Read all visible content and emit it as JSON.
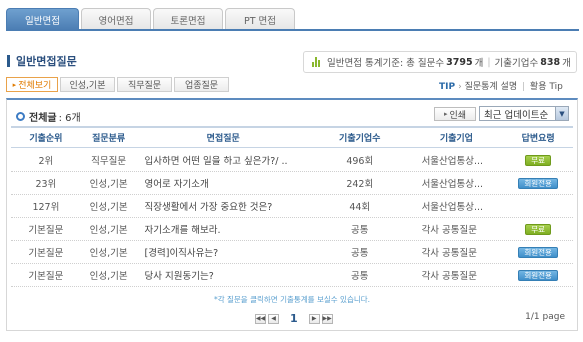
{
  "top_tabs": [
    {
      "label": "일반면접",
      "active": true
    },
    {
      "label": "영어면접",
      "active": false
    },
    {
      "label": "토론면접",
      "active": false
    },
    {
      "label": "PT 면접",
      "active": false
    }
  ],
  "section_title": "일반면접질문",
  "stats": {
    "prefix": "일반면접 통계기준: 총 질문수",
    "question_count": "3795",
    "unit1": "개",
    "company_label": "기출기업수",
    "company_count": "838",
    "unit2": "개"
  },
  "sub_tabs": [
    {
      "label": "전체보기",
      "active": true
    },
    {
      "label": "인성,기본",
      "active": false
    },
    {
      "label": "직무질문",
      "active": false
    },
    {
      "label": "업종질문",
      "active": false
    }
  ],
  "tip": {
    "label": "TIP",
    "link1": "질문통계 설명",
    "link2": "활용 Tip"
  },
  "list": {
    "total_label": "전체글",
    "total_count": ": 6개",
    "print_label": "인쇄",
    "sort_selected": "최근 업데이트순",
    "columns": [
      "기출순위",
      "질문분류",
      "면접질문",
      "기출기업수",
      "기출기업",
      "답변요령"
    ],
    "rows": [
      {
        "rank": "2위",
        "category": "직무질문",
        "question": "입사하면 어떤 일을 하고 싶은가?/ ..",
        "count": "496회",
        "company": "서울산업통상...",
        "answer": "무료",
        "answer_type": "free"
      },
      {
        "rank": "23위",
        "category": "인성,기본",
        "question": "영어로 자기소개",
        "count": "242회",
        "company": "서울산업통상...",
        "answer": "회원전용",
        "answer_type": "member"
      },
      {
        "rank": "127위",
        "category": "인성,기본",
        "question": "직장생활에서 가장 중요한 것은?",
        "count": "44회",
        "company": "서울산업통상...",
        "answer": "",
        "answer_type": "none"
      },
      {
        "rank": "기본질문",
        "category": "인성,기본",
        "question": "자기소개를 해보라.",
        "count": "공통",
        "company": "각사 공통질문",
        "answer": "무료",
        "answer_type": "free"
      },
      {
        "rank": "기본질문",
        "category": "인성,기본",
        "question": "[경력]이직사유는?",
        "count": "공통",
        "company": "각사 공통질문",
        "answer": "회원전용",
        "answer_type": "member"
      },
      {
        "rank": "기본질문",
        "category": "인성,기본",
        "question": "당사 지원동기는?",
        "count": "공통",
        "company": "각사 공통질문",
        "answer": "회원전용",
        "answer_type": "member"
      }
    ],
    "footnote": "*각 질문을 클릭하면 기출통계를 보실수 있습니다.",
    "pager": {
      "current": "1",
      "info": "1/1 page"
    }
  }
}
